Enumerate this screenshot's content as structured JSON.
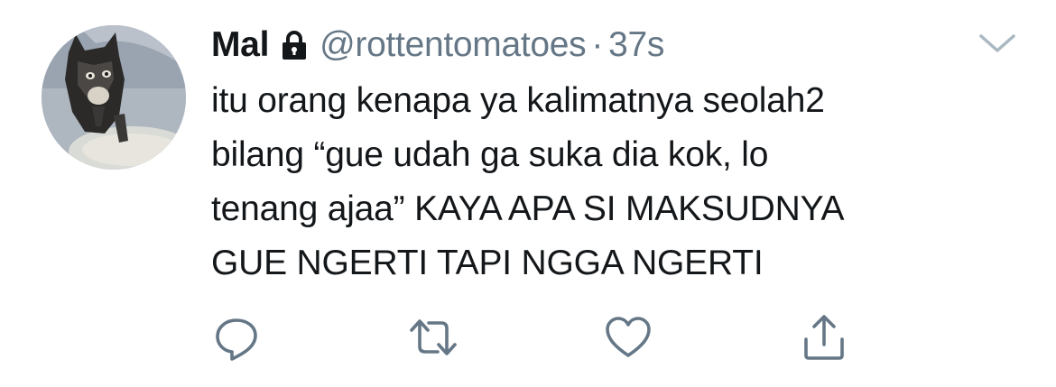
{
  "tweet": {
    "display_name": "Mal",
    "protected_icon": "lock-icon",
    "handle": "@rottentomatoes",
    "separator": "·",
    "time": "37s",
    "text": "itu orang kenapa ya kalimatnya seolah2\nbilang “gue udah ga suka dia kok, lo\ntenang ajaa” KAYA APA SI MAKSUDNYA\nGUE NGERTI TAPI NGGA NGERTI",
    "avatar_icon": "avatar-image",
    "menu_icon": "chevron-down-icon"
  },
  "actions": {
    "reply_icon": "reply-icon",
    "retweet_icon": "retweet-icon",
    "like_icon": "heart-icon",
    "share_icon": "share-icon"
  },
  "colors": {
    "text": "#14171a",
    "secondary": "#657786",
    "icon": "#657786",
    "chevron": "#aab8c2"
  }
}
